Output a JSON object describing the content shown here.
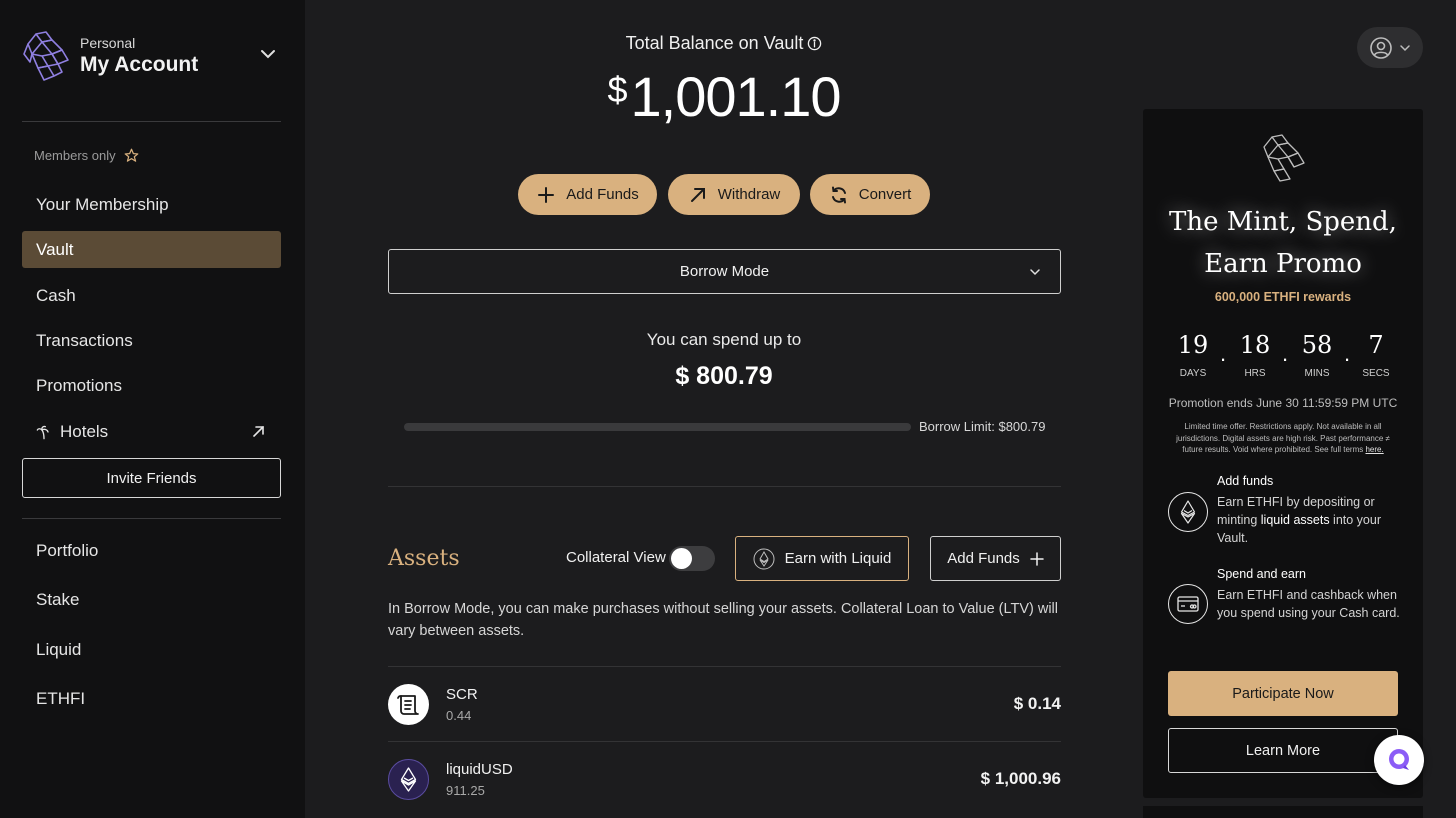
{
  "account": {
    "type_label": "Personal",
    "name": "My Account"
  },
  "sidebar": {
    "members_label": "Members only",
    "items_top": [
      {
        "label": "Your Membership",
        "active": false
      },
      {
        "label": "Vault",
        "active": true
      },
      {
        "label": "Cash",
        "active": false
      },
      {
        "label": "Transactions",
        "active": false
      },
      {
        "label": "Promotions",
        "active": false
      },
      {
        "label": "Hotels",
        "active": false,
        "external": true
      }
    ],
    "invite_label": "Invite Friends",
    "items_bottom": [
      {
        "label": "Portfolio"
      },
      {
        "label": "Stake"
      },
      {
        "label": "Liquid"
      },
      {
        "label": "ETHFI"
      }
    ]
  },
  "balance": {
    "title": "Total Balance on Vault",
    "currency": "$",
    "amount": "1,001.10"
  },
  "actions": {
    "add_funds": "Add Funds",
    "withdraw": "Withdraw",
    "convert": "Convert"
  },
  "mode": {
    "selected": "Borrow Mode"
  },
  "spend": {
    "label": "You can spend up to",
    "amount": "$ 800.79",
    "progress_fraction": 0.0,
    "limit_text": "Borrow Limit: $800.79"
  },
  "assets": {
    "title": "Assets",
    "collateral_view_label": "Collateral View",
    "collateral_view_on": false,
    "earn_button": "Earn with Liquid",
    "add_funds_button": "Add Funds",
    "description": "In Borrow Mode, you can make purchases without selling your assets. Collateral Loan to Value (LTV) will vary between assets.",
    "rows": [
      {
        "name": "SCR",
        "qty": "0.44",
        "value": "$ 0.14"
      },
      {
        "name": "liquidUSD",
        "qty": "911.25",
        "value": "$ 1,000.96"
      }
    ]
  },
  "promo": {
    "title_line1": "The Mint, Spend,",
    "title_line2": "Earn Promo",
    "subtitle": "600,000 ETHFI rewards",
    "countdown": [
      {
        "value": "19",
        "unit": "DAYS"
      },
      {
        "value": "18",
        "unit": "HRS"
      },
      {
        "value": "58",
        "unit": "MINS"
      },
      {
        "value": "7",
        "unit": "SECS"
      }
    ],
    "ends": "Promotion ends June 30 11:59:59 PM UTC",
    "fine_print": "Limited time offer. Restrictions apply. Not available in all jurisdictions. Digital assets are high risk. Past performance ≠ future results. Void where prohibited. See full terms",
    "fine_link": "here.",
    "feature1_title": "Add funds",
    "feature1_pre": "Earn ETHFI by depositing or minting ",
    "feature1_bold": "liquid assets",
    "feature1_post": " into your Vault.",
    "feature2_title": "Spend and earn",
    "feature2_text": "Earn ETHFI and cashback when you spend using your Cash card.",
    "participate": "Participate Now",
    "learn_more": "Learn More"
  },
  "colors": {
    "accent": "#d9b17f",
    "active_nav": "#5b4b36",
    "background": "#1c1c1e",
    "sidebar": "#111112"
  },
  "icons": {
    "logo": "ether-fi-logo-icon",
    "info": "info-icon",
    "user": "user-circle-icon",
    "chat": "chat-bubble-icon"
  }
}
